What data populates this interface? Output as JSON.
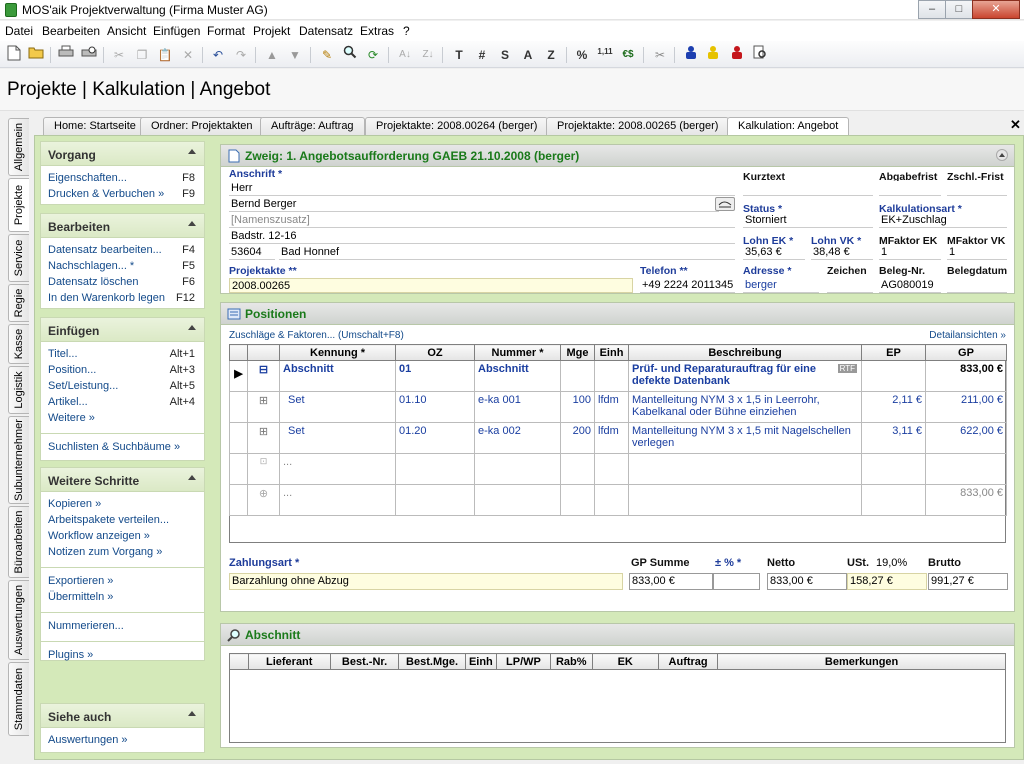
{
  "window": {
    "title": "MOS'aik Projektverwaltung (Firma Muster AG)",
    "min": "–",
    "max": "□",
    "close": "✕"
  },
  "menu": [
    "Datei",
    "Bearbeiten",
    "Ansicht",
    "Einfügen",
    "Format",
    "Projekt",
    "Datensatz",
    "Extras",
    "?"
  ],
  "toolbar": {
    "bold_t": "T",
    "hash": "#",
    "s": "S",
    "a": "A",
    "z": "Z",
    "percent": "%",
    "nums": "1,11",
    "euro": "€$"
  },
  "page_title": "Projekte | Kalkulation | Angebot",
  "tabs": [
    "Home: Startseite",
    "Ordner: Projektakten",
    "Aufträge: Auftrag",
    "Projektakte: 2008.00264 (berger)",
    "Projektakte: 2008.00265 (berger)",
    "Kalkulation: Angebot"
  ],
  "tab_close": "✕",
  "vtabs": [
    "Allgemein",
    "Projekte",
    "Service",
    "Regie",
    "Kasse",
    "Logistik",
    "Subunternehmer",
    "Büroarbeiten",
    "Auswertungen",
    "Stammdaten"
  ],
  "left": {
    "vorgang": {
      "title": "Vorgang",
      "items": [
        {
          "label": "Eigenschaften...",
          "key": "F8"
        },
        {
          "label": "Drucken & Verbuchen »",
          "key": "F9"
        }
      ]
    },
    "bearbeiten": {
      "title": "Bearbeiten",
      "items": [
        {
          "label": "Datensatz bearbeiten...",
          "key": "F4"
        },
        {
          "label": "Nachschlagen... *",
          "key": "F5"
        },
        {
          "label": "Datensatz löschen",
          "key": "F6"
        },
        {
          "label": "In den Warenkorb legen",
          "key": "F12"
        }
      ]
    },
    "einfuegen": {
      "title": "Einfügen",
      "items": [
        {
          "label": "Titel...",
          "key": "Alt+1"
        },
        {
          "label": "Position...",
          "key": "Alt+3"
        },
        {
          "label": "Set/Leistung...",
          "key": "Alt+5"
        },
        {
          "label": "Artikel...",
          "key": "Alt+4"
        },
        {
          "label": "Weitere »",
          "key": ""
        }
      ],
      "extra": "Suchlisten & Suchbäume »"
    },
    "weitere": {
      "title": "Weitere Schritte",
      "items": [
        "Kopieren »",
        "Arbeitspakete verteilen...",
        "Workflow anzeigen »",
        "Notizen zum Vorgang »"
      ],
      "items2": [
        "Exportieren »",
        "Übermitteln »"
      ],
      "items3": [
        "Nummerieren..."
      ],
      "items4": [
        "Plugins »"
      ]
    },
    "siehe": {
      "title": "Siehe auch",
      "items": [
        "Auswertungen »"
      ]
    }
  },
  "header_section": {
    "title": "Zweig: 1. Angebotsaufforderung GAEB 21.10.2008 (berger)",
    "anschrift_label": "Anschrift *",
    "anrede": "Herr",
    "name": "Bernd Berger",
    "zusatz_placeholder": "[Namenszusatz]",
    "strasse": "Badstr. 12-16",
    "plz": "53604",
    "ort": "Bad Honnef",
    "projektakte_label": "Projektakte **",
    "projektakte": "2008.00265",
    "telefon_label": "Telefon **",
    "telefon": "+49 2224 2011345",
    "kurztext_label": "Kurztext",
    "kurztext": "",
    "abgabefrist_label": "Abgabefrist",
    "abgabefrist": "",
    "zschl_label": "Zschl.-Frist",
    "zschl": "",
    "status_label": "Status *",
    "status": "Storniert",
    "kalkart_label": "Kalkulationsart *",
    "kalkart": "EK+Zuschlag",
    "lohnek_label": "Lohn EK *",
    "lohnek": "35,63 €",
    "lohnvk_label": "Lohn VK *",
    "lohnvk": "38,48 €",
    "mfek_label": "MFaktor EK",
    "mfek": "1",
    "mfvk_label": "MFaktor VK",
    "mfvk": "1",
    "adresse_label": "Adresse *",
    "adresse": "berger",
    "zeichen_label": "Zeichen",
    "zeichen": "",
    "belegnr_label": "Beleg-Nr.",
    "belegnr": "AG080019",
    "belegdatum_label": "Belegdatum",
    "belegdatum": ""
  },
  "positionen": {
    "title": "Positionen",
    "link_left": "Zuschläge & Faktoren... (Umschalt+F8)",
    "link_right": "Detailansichten »",
    "columns": [
      "Kennung *",
      "OZ",
      "Nummer *",
      "Mge",
      "Einh",
      "Beschreibung",
      "EP",
      "GP"
    ],
    "rows": [
      {
        "kennung": "Abschnitt",
        "oz": "01",
        "nummer": "Abschnitt",
        "mge": "",
        "einh": "",
        "beschreibung": "Prüf- und Reparaturauftrag für eine defekte Datenbank",
        "ep": "",
        "gp": "833,00 €",
        "rtf": "RTF"
      },
      {
        "kennung": "Set",
        "oz": "01.10",
        "nummer": "e-ka 001",
        "mge": "100",
        "einh": "lfdm",
        "beschreibung": "Mantelleitung NYM 3 x 1,5 in Leerrohr, Kabelkanal oder Bühne einziehen",
        "ep": "2,11 €",
        "gp": "211,00 €"
      },
      {
        "kennung": "Set",
        "oz": "01.20",
        "nummer": "e-ka 002",
        "mge": "200",
        "einh": "lfdm",
        "beschreibung": "Mantelleitung NYM 3 x 1,5 mit Nagelschellen verlegen",
        "ep": "3,11 €",
        "gp": "622,00 €"
      },
      {
        "kennung": "...",
        "oz": "",
        "nummer": "",
        "mge": "",
        "einh": "",
        "beschreibung": "",
        "ep": "",
        "gp": ""
      },
      {
        "kennung": "...",
        "oz": "",
        "nummer": "",
        "mge": "",
        "einh": "",
        "beschreibung": "",
        "ep": "",
        "gp": "833,00 €"
      }
    ],
    "zahlungsart_label": "Zahlungsart *",
    "zahlungsart": "Barzahlung ohne Abzug",
    "gpsumme_label": "GP Summe",
    "gpsumme": "833,00 €",
    "pm_label": "± % *",
    "pm": "",
    "netto_label": "Netto",
    "netto": "833,00 €",
    "ust_label": "USt.",
    "ust_rate": "19,0%",
    "ust": "158,27 €",
    "brutto_label": "Brutto",
    "brutto": "991,27 €"
  },
  "abschnitt": {
    "title": "Abschnitt",
    "columns": [
      "Lieferant",
      "Best.-Nr.",
      "Best.Mge.",
      "Einh",
      "LP/WP",
      "Rab%",
      "EK",
      "Auftrag",
      "Bemerkungen"
    ]
  }
}
